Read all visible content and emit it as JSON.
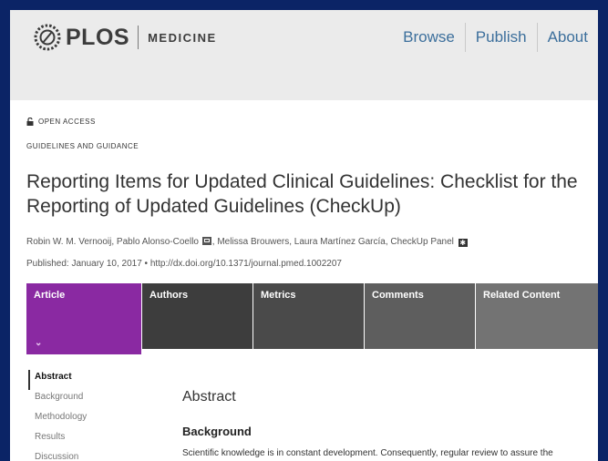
{
  "header": {
    "logo_text": "PLOS",
    "journal_name": "MEDICINE",
    "nav": [
      "Browse",
      "Publish",
      "About"
    ]
  },
  "article": {
    "access_label": "OPEN ACCESS",
    "category": "GUIDELINES AND GUIDANCE",
    "title": "Reporting Items for Updated Clinical Guidelines: Checklist for the Reporting of Updated Guidelines (CheckUp)",
    "authors_part1": "Robin W. M. Vernooij, Pablo Alonso-Coello",
    "authors_part2": ", Melissa Brouwers, Laura Martínez García, CheckUp Panel",
    "published_line": "Published: January 10, 2017 • http://dx.doi.org/10.1371/journal.pmed.1002207"
  },
  "tabs": [
    {
      "label": "Article"
    },
    {
      "label": "Authors"
    },
    {
      "label": "Metrics"
    },
    {
      "label": "Comments"
    },
    {
      "label": "Related Content"
    }
  ],
  "tab_chevron": "⌄",
  "toc": [
    "Abstract",
    "Background",
    "Methodology",
    "Results",
    "Discussion"
  ],
  "content": {
    "section_title": "Abstract",
    "subsection_title": "Background",
    "paragraph": "Scientific knowledge is in constant development. Consequently, regular review to assure the trustworthiness of clinical guidelines is required. However, there is still a lack of preferred"
  },
  "colors": {
    "frame": "#0b2466",
    "article_tab": "#8a29a2",
    "nav_link": "#3c6f9c"
  }
}
